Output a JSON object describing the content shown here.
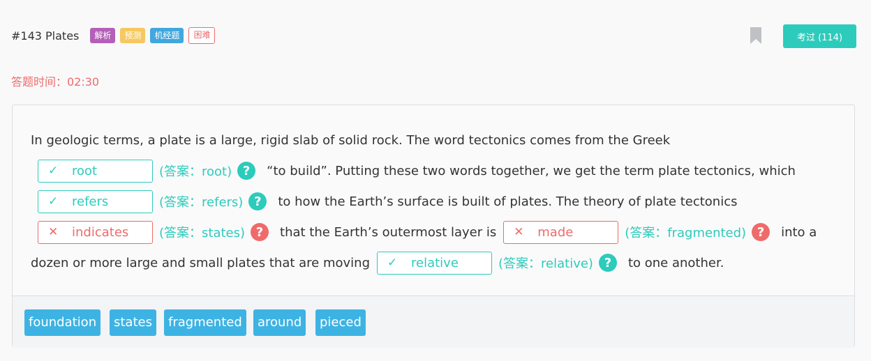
{
  "header": {
    "title": "#143 Plates",
    "tags": [
      "解析",
      "预测",
      "机经题",
      "困难"
    ],
    "exam_button": "考过 (114)"
  },
  "timer": "答题时间：02:30",
  "passage": {
    "line1": "In geologic terms, a plate is a large, rigid slab of solid rock. The word tectonics comes from the Greek",
    "line2_text": "“to build”. Putting these two words together, we get the term plate tectonics, which",
    "line3_text": "to how the Earth’s surface is built of plates. The theory of plate tectonics",
    "line4_text": "that the Earth’s outermost layer is",
    "line4_end": "into a",
    "line5_start": "dozen or more large and small plates that are moving",
    "line5_end": "to one another.",
    "blanks": [
      {
        "value": "root",
        "status": "correct",
        "answer": "(答案：root)"
      },
      {
        "value": "refers",
        "status": "correct",
        "answer": "(答案：refers)"
      },
      {
        "value": "indicates",
        "status": "wrong",
        "answer": "(答案：states)"
      },
      {
        "value": "made",
        "status": "wrong",
        "answer": "(答案：fragmented)"
      },
      {
        "value": "relative",
        "status": "correct",
        "answer": "(答案：relative)"
      }
    ]
  },
  "word_bank": [
    "foundation",
    "states",
    "fragmented",
    "around",
    "pieced"
  ],
  "icons": {
    "check": "✓",
    "cross": "✕",
    "help": "?"
  },
  "colors": {
    "correct": "#2dcbbc",
    "wrong": "#ef6b6b",
    "chip": "#3db3e4"
  }
}
